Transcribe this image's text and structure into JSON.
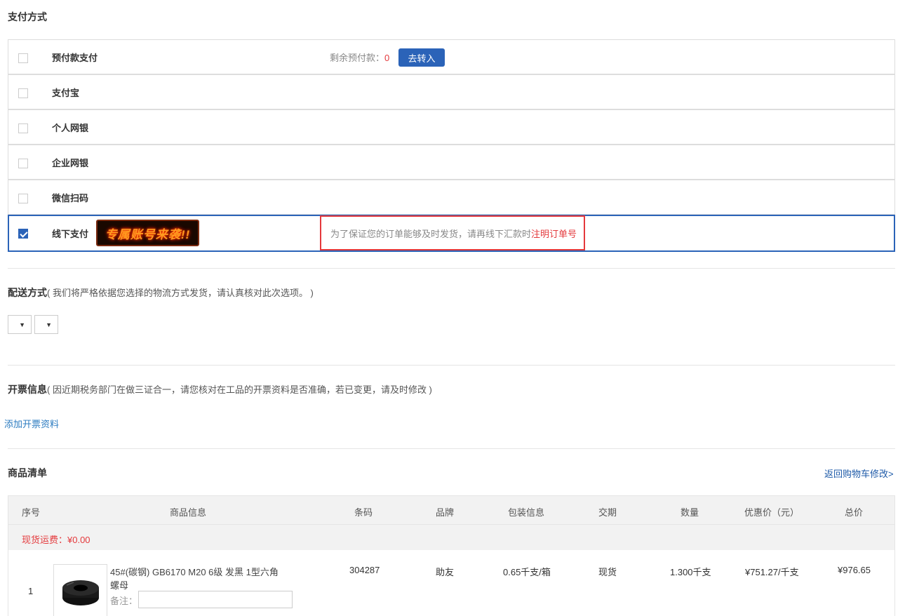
{
  "payment": {
    "title": "支付方式",
    "options": [
      {
        "label": "预付款支付",
        "checked": false
      },
      {
        "label": "支付宝",
        "checked": false
      },
      {
        "label": "个人网银",
        "checked": false
      },
      {
        "label": "企业网银",
        "checked": false
      },
      {
        "label": "微信扫码",
        "checked": false
      },
      {
        "label": "线下支付",
        "checked": true
      }
    ],
    "balance_label": "剩余预付款：",
    "balance_value": "0",
    "transfer_button": "去转入",
    "promo_badge": "专属账号来袭!!",
    "offline_note": "为了保证您的订单能够及时发货，请再线下汇款时",
    "offline_note_emphasis": "注明订单号"
  },
  "delivery": {
    "title": "配送方式",
    "note": "( 我们将严格依据您选择的物流方式发货，请认真核对此次选项。 )",
    "select_arrow": "▼"
  },
  "invoice": {
    "title": "开票信息",
    "note": "( 因近期税务部门在做三证合一，请您核对在工品的开票资料是否准确，若已变更，请及时修改 )",
    "add_link": "添加开票资料"
  },
  "goods": {
    "title": "商品清单",
    "back_link": "返回购物车修改>",
    "columns": [
      "序号",
      "商品信息",
      "条码",
      "品牌",
      "包装信息",
      "交期",
      "数量",
      "优惠价（元）",
      "总价"
    ],
    "freight": "现货运费：¥0.00",
    "rows": [
      {
        "index": "1",
        "name_line1": "45#(碳钢)  GB6170  M20  6级  发黑  1型六角",
        "name_line2": "螺母",
        "remark_label": "备注：",
        "barcode": "304287",
        "brand": "助友",
        "packing": "0.65千支/箱",
        "delivery": "现货",
        "quantity": "1.300千支",
        "price": "¥751.27/千支",
        "total": "¥976.65"
      }
    ]
  },
  "colors": {
    "accent": "#2b63b8",
    "alert": "#e4393c",
    "link": "#2b7bc0"
  }
}
